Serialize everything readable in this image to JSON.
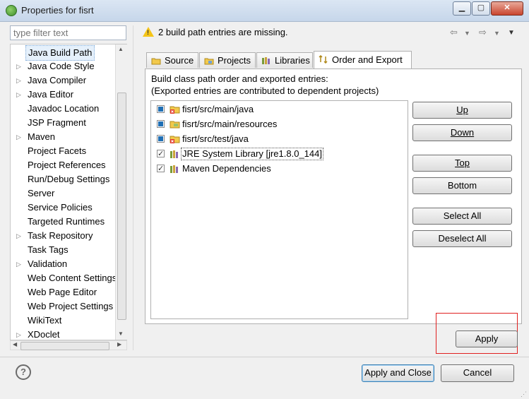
{
  "window": {
    "title": "Properties for fisrt",
    "minimize": "▁",
    "maximize": "▢",
    "close": "✕"
  },
  "filter": {
    "placeholder": "type filter text"
  },
  "tree": {
    "items": [
      {
        "label": "Java Build Path",
        "expandable": false,
        "selected": true
      },
      {
        "label": "Java Code Style",
        "expandable": true
      },
      {
        "label": "Java Compiler",
        "expandable": true
      },
      {
        "label": "Java Editor",
        "expandable": true
      },
      {
        "label": "Javadoc Location",
        "expandable": false
      },
      {
        "label": "JSP Fragment",
        "expandable": false
      },
      {
        "label": "Maven",
        "expandable": true
      },
      {
        "label": "Project Facets",
        "expandable": false
      },
      {
        "label": "Project References",
        "expandable": false
      },
      {
        "label": "Run/Debug Settings",
        "expandable": false
      },
      {
        "label": "Server",
        "expandable": false
      },
      {
        "label": "Service Policies",
        "expandable": false
      },
      {
        "label": "Targeted Runtimes",
        "expandable": false
      },
      {
        "label": "Task Repository",
        "expandable": true
      },
      {
        "label": "Task Tags",
        "expandable": false
      },
      {
        "label": "Validation",
        "expandable": true
      },
      {
        "label": "Web Content Settings",
        "expandable": false
      },
      {
        "label": "Web Page Editor",
        "expandable": false
      },
      {
        "label": "Web Project Settings",
        "expandable": false
      },
      {
        "label": "WikiText",
        "expandable": false
      },
      {
        "label": "XDoclet",
        "expandable": true
      }
    ]
  },
  "banner": {
    "message": "2 build path entries are missing."
  },
  "tabs": [
    {
      "label": "Source",
      "icon": "source-folder-icon"
    },
    {
      "label": "Projects",
      "icon": "projects-icon"
    },
    {
      "label": "Libraries",
      "icon": "libraries-icon"
    },
    {
      "label": "Order and Export",
      "icon": "order-export-icon",
      "active": true
    }
  ],
  "panel": {
    "description_line1": "Build class path order and exported entries:",
    "description_line2": "(Exported entries are contributed to dependent projects)"
  },
  "entries": [
    {
      "label": "fisrt/src/main/java",
      "checked": "partial",
      "icon": "missing-source-folder-icon"
    },
    {
      "label": "fisrt/src/main/resources",
      "checked": "partial",
      "icon": "source-folder-icon"
    },
    {
      "label": "fisrt/src/test/java",
      "checked": "partial",
      "icon": "missing-source-folder-icon"
    },
    {
      "label": "JRE System Library [jre1.8.0_144]",
      "checked": "checked",
      "icon": "library-icon",
      "selected": true
    },
    {
      "label": "Maven Dependencies",
      "checked": "checked",
      "icon": "library-icon"
    }
  ],
  "buttons": {
    "up": "Up",
    "down": "Down",
    "top": "Top",
    "bottom": "Bottom",
    "select_all": "Select All",
    "deselect_all": "Deselect All",
    "apply": "Apply",
    "apply_close": "Apply and Close",
    "cancel": "Cancel"
  },
  "colors": {
    "highlight_box": "#e02020",
    "accent": "#3c7fb1"
  }
}
